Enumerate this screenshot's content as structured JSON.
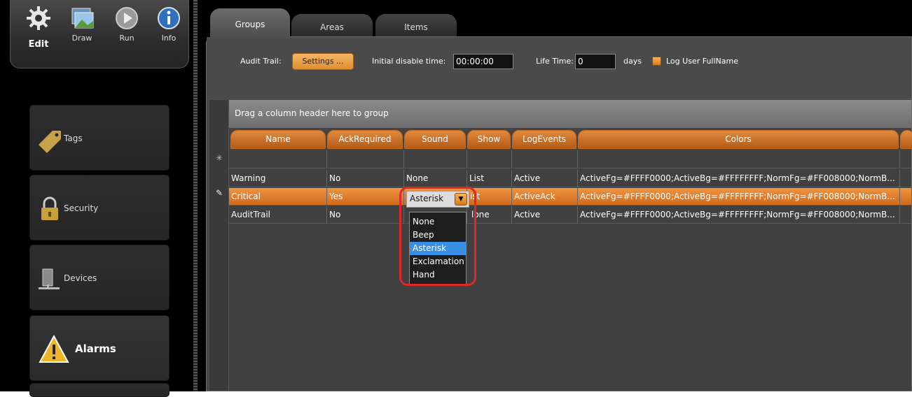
{
  "modes": [
    {
      "label": "Edit",
      "icon": "gear-icon"
    },
    {
      "label": "Draw",
      "icon": "picture-icon"
    },
    {
      "label": "Run",
      "icon": "play-icon"
    },
    {
      "label": "Info",
      "icon": "info-icon"
    }
  ],
  "nav": {
    "tags": "Tags",
    "security": "Security",
    "devices": "Devices",
    "alarms": "Alarms"
  },
  "tabs": {
    "groups": "Groups",
    "areas": "Areas",
    "items": "Items"
  },
  "settings": {
    "audit_label": "Audit Trail:",
    "settings_button": "Settings ...",
    "disable_label": "Initial disable time:",
    "disable_value": "00:00:00",
    "life_label": "Life Time:",
    "life_value": "0",
    "days_label": "days",
    "log_label": "Log User FullName",
    "log_checked": true
  },
  "grid": {
    "group_hint": "Drag a column header here to group",
    "columns": [
      "Name",
      "AckRequired",
      "Sound",
      "Show",
      "LogEvents",
      "Colors"
    ],
    "rows": [
      {
        "name": "Warning",
        "ack": "No",
        "sound": "None",
        "show": "List",
        "log": "Active",
        "colors": "ActiveFg=#FFFF0000;ActiveBg=#FFFFFFFF;NormFg=#FF008000;NormB..."
      },
      {
        "name": "Critical",
        "ack": "Yes",
        "sound": "Asterisk",
        "show": "List",
        "log": "ActiveAck",
        "colors": "ActiveFg=#FFFF0000;ActiveBg=#FFFFFFFF;NormFg=#FF008000;NormB..."
      },
      {
        "name": "AuditTrail",
        "ack": "No",
        "sound": "",
        "show": "None",
        "log": "Active",
        "colors": "ActiveFg=#FFFF0000;ActiveBg=#FFFFFFFF;NormFg=#FF008000;NormB..."
      }
    ],
    "visible_show_critical": "ist",
    "visible_show_audit": "lone"
  },
  "sound_editor": {
    "value": "Asterisk",
    "options": [
      "None",
      "Beep",
      "Asterisk",
      "Exclamation",
      "Hand"
    ],
    "selected_index": 2
  },
  "colors": {
    "accent_orange": "#e08b3e",
    "selection_blue": "#3a8ee6",
    "callout_red": "#e0262b"
  }
}
